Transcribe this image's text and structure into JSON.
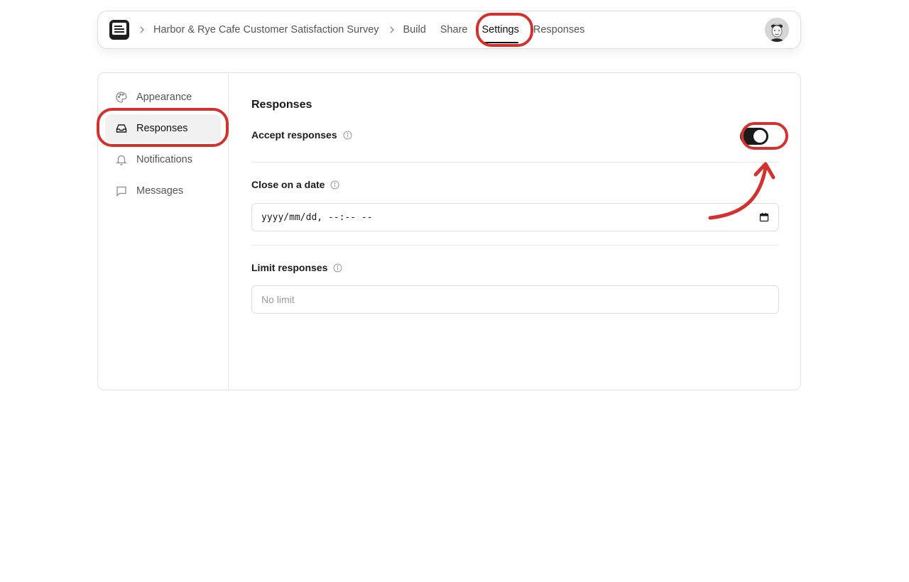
{
  "topbar": {
    "logo": "form-logo-icon",
    "breadcrumb_title": "Harbor & Rye Cafe Customer Satisfaction Survey",
    "tabs": [
      {
        "label": "Build",
        "active": false
      },
      {
        "label": "Share",
        "active": false
      },
      {
        "label": "Settings",
        "active": true
      },
      {
        "label": "Responses",
        "active": false
      }
    ]
  },
  "sidebar": {
    "items": [
      {
        "label": "Appearance",
        "icon": "palette-icon",
        "active": false
      },
      {
        "label": "Responses",
        "icon": "inbox-icon",
        "active": true
      },
      {
        "label": "Notifications",
        "icon": "bell-icon",
        "active": false
      },
      {
        "label": "Messages",
        "icon": "message-icon",
        "active": false
      }
    ]
  },
  "main": {
    "section_title": "Responses",
    "accept_responses": {
      "label": "Accept responses",
      "enabled": true
    },
    "close_on_date": {
      "label": "Close on a date",
      "value": "yyyy/mm/dd, --:-- --"
    },
    "limit_responses": {
      "label": "Limit responses",
      "placeholder": "No limit"
    }
  },
  "colors": {
    "accent": "#1a1a1a",
    "annotation": "#d3312e",
    "active_bg": "#f1f1f1"
  }
}
